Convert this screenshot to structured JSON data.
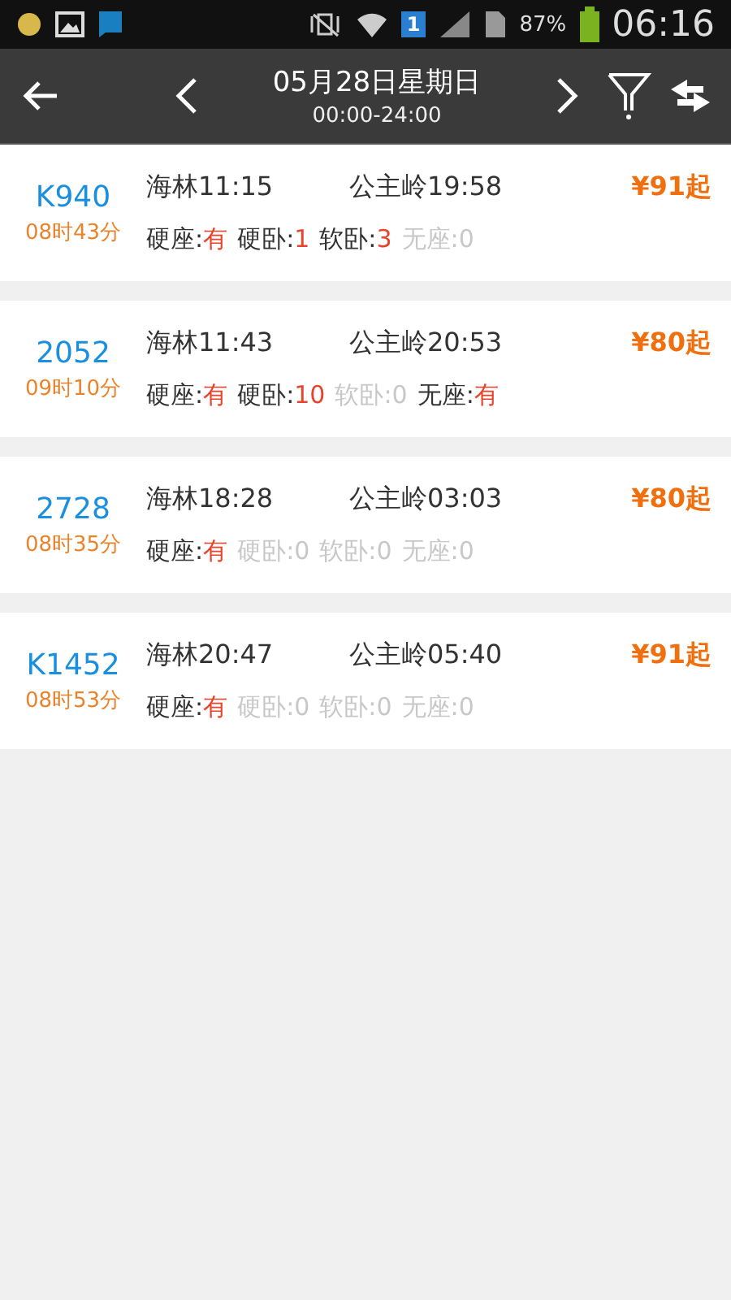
{
  "status_bar": {
    "sim_badge": "1",
    "battery_text": "87%",
    "time": "06:16"
  },
  "header": {
    "date": "05月28日星期日",
    "time_range": "00:00-24:00"
  },
  "trains": [
    {
      "number": "K940",
      "duration": "08时43分",
      "depart": "海林11:15",
      "arrive": "公主岭19:58",
      "price": "¥91起",
      "seats": [
        {
          "label": "硬座:",
          "value": "有",
          "available": true
        },
        {
          "label": "硬卧:",
          "value": "1",
          "available": true
        },
        {
          "label": "软卧:",
          "value": "3",
          "available": true
        },
        {
          "label": "无座:",
          "value": "0",
          "available": false
        }
      ]
    },
    {
      "number": "2052",
      "duration": "09时10分",
      "depart": "海林11:43",
      "arrive": "公主岭20:53",
      "price": "¥80起",
      "seats": [
        {
          "label": "硬座:",
          "value": "有",
          "available": true
        },
        {
          "label": "硬卧:",
          "value": "10",
          "available": true
        },
        {
          "label": "软卧:",
          "value": "0",
          "available": false
        },
        {
          "label": "无座:",
          "value": "有",
          "available": true
        }
      ]
    },
    {
      "number": "2728",
      "duration": "08时35分",
      "depart": "海林18:28",
      "arrive": "公主岭03:03",
      "price": "¥80起",
      "seats": [
        {
          "label": "硬座:",
          "value": "有",
          "available": true
        },
        {
          "label": "硬卧:",
          "value": "0",
          "available": false
        },
        {
          "label": "软卧:",
          "value": "0",
          "available": false
        },
        {
          "label": "无座:",
          "value": "0",
          "available": false
        }
      ]
    },
    {
      "number": "K1452",
      "duration": "08时53分",
      "depart": "海林20:47",
      "arrive": "公主岭05:40",
      "price": "¥91起",
      "seats": [
        {
          "label": "硬座:",
          "value": "有",
          "available": true
        },
        {
          "label": "硬卧:",
          "value": "0",
          "available": false
        },
        {
          "label": "软卧:",
          "value": "0",
          "available": false
        },
        {
          "label": "无座:",
          "value": "0",
          "available": false
        }
      ]
    }
  ]
}
